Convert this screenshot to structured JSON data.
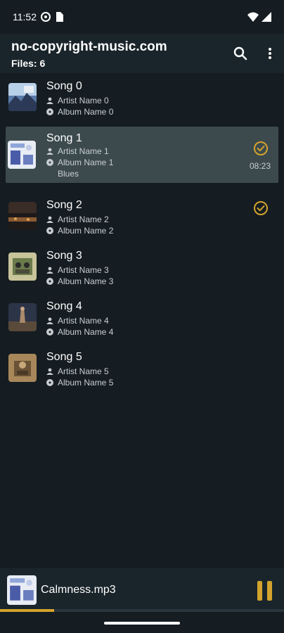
{
  "status": {
    "time": "11:52"
  },
  "app": {
    "title": "no-copyright-music.com",
    "subtitle": "Files: 6"
  },
  "songs": [
    {
      "title": "Song 0",
      "artist": "Artist Name 0",
      "album": "Album Name 0",
      "genre": "",
      "duration": "",
      "checked": false
    },
    {
      "title": "Song 1",
      "artist": "Artist Name 1",
      "album": "Album Name 1",
      "genre": "Blues",
      "duration": "08:23",
      "checked": true
    },
    {
      "title": "Song 2",
      "artist": "Artist Name 2",
      "album": "Album Name 2",
      "genre": "",
      "duration": "",
      "checked": true
    },
    {
      "title": "Song 3",
      "artist": "Artist Name 3",
      "album": "Album Name 3",
      "genre": "",
      "duration": "",
      "checked": false
    },
    {
      "title": "Song 4",
      "artist": "Artist Name 4",
      "album": "Album Name 4",
      "genre": "",
      "duration": "",
      "checked": false
    },
    {
      "title": "Song 5",
      "artist": "Artist Name 5",
      "album": "Album Name 5",
      "genre": "",
      "duration": "",
      "checked": false
    }
  ],
  "player": {
    "file": "Calmness.mp3",
    "progress": 0.19
  },
  "colors": {
    "accent": "#d4a32d",
    "background": "#151d22",
    "selected_row": "#3c4a4d"
  },
  "icons": {
    "search": "search-icon",
    "more": "more-vert-icon",
    "artist": "person-icon",
    "album": "disc-icon",
    "check": "check-circle-icon",
    "pause": "pause-icon"
  }
}
